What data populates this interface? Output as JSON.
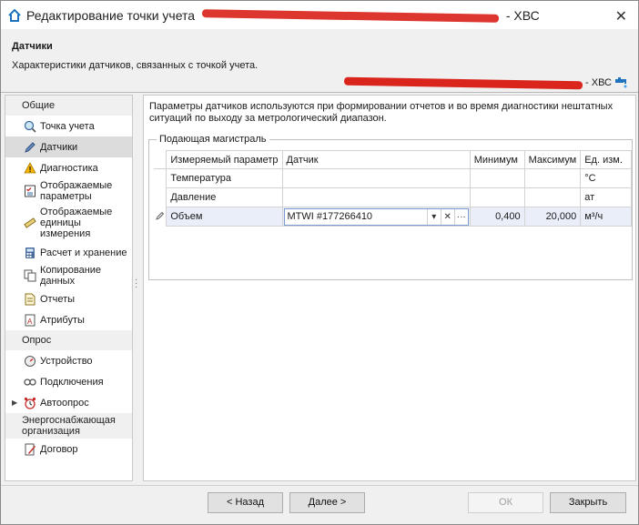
{
  "window": {
    "title_prefix": "Редактирование точки учета",
    "title_suffix": "- ХВС",
    "close_glyph": "✕"
  },
  "header": {
    "title": "Датчики",
    "subtitle": "Характеристики датчиков, связанных с точкой учета.",
    "right_suffix": "- ХВС"
  },
  "nav": {
    "groups": [
      {
        "label": "Общие"
      },
      {
        "label": "Опрос"
      },
      {
        "label": "Энергоснабжающая организация"
      }
    ],
    "items": [
      {
        "label": "Точка учета",
        "icon": "magnifier-icon"
      },
      {
        "label": "Датчики",
        "icon": "pencil-icon"
      },
      {
        "label": "Диагностика",
        "icon": "warning-icon"
      },
      {
        "label": "Отображаемые параметры",
        "icon": "checklist-icon"
      },
      {
        "label": "Отображаемые единицы измерения",
        "icon": "ruler-icon"
      },
      {
        "label": "Расчет и хранение",
        "icon": "calculator-icon"
      },
      {
        "label": "Копирование данных",
        "icon": "copy-icon"
      },
      {
        "label": "Отчеты",
        "icon": "document-icon"
      },
      {
        "label": "Атрибуты",
        "icon": "attribute-icon"
      },
      {
        "label": "Устройство",
        "icon": "gauge-icon"
      },
      {
        "label": "Подключения",
        "icon": "connection-icon"
      },
      {
        "label": "Автоопрос",
        "icon": "alarm-clock-icon"
      },
      {
        "label": "Договор",
        "icon": "contract-icon"
      }
    ]
  },
  "content": {
    "description": "Параметры датчиков используются при формировании отчетов и во время диагностики нештатных ситуаций по выходу за метрологический диапазон.",
    "fieldset_legend": "Подающая магистраль",
    "columns": [
      "Измеряемый параметр",
      "Датчик",
      "Минимум",
      "Максимум",
      "Ед. изм."
    ],
    "rows": [
      {
        "param": "Температура",
        "sensor": "",
        "min": "",
        "max": "",
        "unit": "°С"
      },
      {
        "param": "Давление",
        "sensor": "",
        "min": "",
        "max": "",
        "unit": "ат"
      },
      {
        "param": "Объем",
        "sensor": "MTWI #177266410",
        "min": "0,400",
        "max": "20,000",
        "unit": "м³/ч"
      }
    ]
  },
  "footer": {
    "back": "< Назад",
    "next": "Далее >",
    "ok": "ОК",
    "close": "Закрыть"
  },
  "colors": {
    "redaction": "#d9251c",
    "selection": "#e9eef8",
    "accent": "#1e73be"
  }
}
